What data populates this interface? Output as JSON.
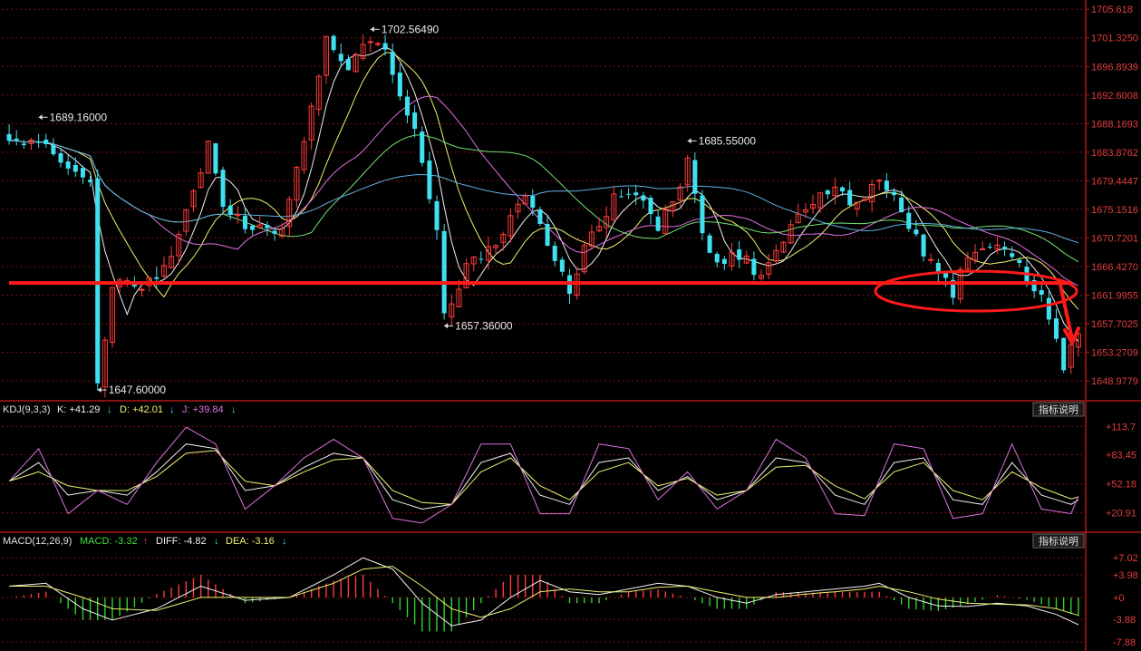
{
  "colors": {
    "background": "#000000",
    "up": "#ff3b3b",
    "down": "#3fe0f0",
    "frame": "#b01818",
    "axis_text": "#e43d3d",
    "grid": "#7a1010",
    "ma_white": "#f0f0f0",
    "ma_yellow": "#f0f070",
    "ma_magenta": "#e070e0",
    "ma_green": "#70e070",
    "ma_cyan": "#60b0e0",
    "annotation": "#ff1a1a",
    "label_bg": "#111111",
    "label_border": "#555555"
  },
  "price_panel": {
    "y_ticks": [
      "1705.618",
      "1701.3250",
      "1696.8939",
      "1692.6008",
      "1688.1693",
      "1683.8762",
      "1679.4447",
      "1675.1516",
      "1670.7201",
      "1666.4270",
      "1661.9955",
      "1657.7025",
      "1653.2709",
      "1648.9779"
    ],
    "callouts": [
      {
        "text": "1702.56490",
        "value": 1702.5649,
        "index": 49
      },
      {
        "text": "1689.16000",
        "value": 1689.16,
        "index": 4
      },
      {
        "text": "1685.55000",
        "value": 1685.55,
        "index": 92
      },
      {
        "text": "1657.36000",
        "value": 1657.36,
        "index": 59
      },
      {
        "text": "1647.60000",
        "value": 1647.6,
        "index": 12
      }
    ],
    "support_line": 1663.9
  },
  "kdj_panel": {
    "legend": {
      "title": "KDJ(9,3,3)",
      "k": "K: +41.29",
      "d": "D: +42.01",
      "j": "J: +39.84"
    },
    "explain_button": "指标说明",
    "y_ticks": [
      "+113.7",
      "+83.45",
      "+52.18",
      "+20.91"
    ]
  },
  "macd_panel": {
    "legend": {
      "title": "MACD(12,26,9)",
      "macd": "MACD: -3.32",
      "diff": "DIFF: -4.82",
      "dea": "DEA: -3.16"
    },
    "explain_button": "指标说明",
    "y_ticks": [
      "+7.02",
      "+3.98",
      "+0",
      "-3.88",
      "-7.88"
    ]
  },
  "chart_data": {
    "type": "candlestick",
    "ylim": [
      1646.5,
      1706.2
    ],
    "close_path": [
      [
        0,
        1685
      ],
      [
        4,
        1686
      ],
      [
        7,
        1683
      ],
      [
        9,
        1681.5
      ],
      [
        11,
        1679
      ],
      [
        12,
        1649
      ],
      [
        14,
        1663
      ],
      [
        16,
        1665
      ],
      [
        18,
        1663
      ],
      [
        22,
        1667
      ],
      [
        27,
        1685
      ],
      [
        29,
        1676
      ],
      [
        33,
        1672
      ],
      [
        37,
        1672
      ],
      [
        43,
        1701
      ],
      [
        46,
        1697
      ],
      [
        49,
        1701
      ],
      [
        51,
        1699
      ],
      [
        55,
        1687
      ],
      [
        58,
        1672
      ],
      [
        59,
        1659
      ],
      [
        62,
        1666
      ],
      [
        66,
        1670
      ],
      [
        70,
        1678
      ],
      [
        74,
        1667
      ],
      [
        76,
        1663
      ],
      [
        79,
        1672
      ],
      [
        83,
        1678
      ],
      [
        86,
        1677
      ],
      [
        88,
        1672
      ],
      [
        90,
        1677
      ],
      [
        92,
        1682
      ],
      [
        94,
        1672
      ],
      [
        96,
        1666
      ],
      [
        98,
        1668
      ],
      [
        100,
        1667
      ],
      [
        102,
        1664
      ],
      [
        104,
        1669
      ],
      [
        106,
        1673
      ],
      [
        109,
        1676
      ],
      [
        112,
        1678
      ],
      [
        115,
        1676
      ],
      [
        118,
        1679
      ],
      [
        120,
        1678
      ],
      [
        122,
        1673
      ],
      [
        124,
        1668
      ],
      [
        126,
        1666
      ],
      [
        128,
        1662
      ],
      [
        130,
        1668
      ],
      [
        132,
        1670
      ],
      [
        134,
        1669
      ],
      [
        136,
        1667
      ],
      [
        138,
        1665
      ],
      [
        140,
        1662
      ],
      [
        142,
        1656
      ],
      [
        143,
        1650
      ],
      [
        145,
        1657
      ]
    ],
    "kdj_k_path": [
      [
        0,
        55
      ],
      [
        4,
        75
      ],
      [
        8,
        40
      ],
      [
        12,
        45
      ],
      [
        16,
        40
      ],
      [
        20,
        65
      ],
      [
        24,
        95
      ],
      [
        28,
        90
      ],
      [
        32,
        45
      ],
      [
        36,
        50
      ],
      [
        40,
        70
      ],
      [
        44,
        85
      ],
      [
        48,
        80
      ],
      [
        52,
        35
      ],
      [
        56,
        25
      ],
      [
        60,
        30
      ],
      [
        64,
        75
      ],
      [
        68,
        85
      ],
      [
        72,
        40
      ],
      [
        76,
        30
      ],
      [
        80,
        75
      ],
      [
        84,
        80
      ],
      [
        88,
        45
      ],
      [
        92,
        60
      ],
      [
        96,
        35
      ],
      [
        100,
        45
      ],
      [
        104,
        80
      ],
      [
        108,
        75
      ],
      [
        112,
        40
      ],
      [
        116,
        30
      ],
      [
        120,
        75
      ],
      [
        124,
        80
      ],
      [
        128,
        35
      ],
      [
        132,
        30
      ],
      [
        136,
        75
      ],
      [
        140,
        40
      ],
      [
        144,
        30
      ],
      [
        145,
        35
      ]
    ],
    "kdj_d_path": [
      [
        0,
        55
      ],
      [
        4,
        65
      ],
      [
        8,
        50
      ],
      [
        12,
        45
      ],
      [
        16,
        45
      ],
      [
        20,
        60
      ],
      [
        24,
        85
      ],
      [
        28,
        88
      ],
      [
        32,
        55
      ],
      [
        36,
        50
      ],
      [
        40,
        65
      ],
      [
        44,
        78
      ],
      [
        48,
        80
      ],
      [
        52,
        45
      ],
      [
        56,
        32
      ],
      [
        60,
        30
      ],
      [
        64,
        65
      ],
      [
        68,
        80
      ],
      [
        72,
        50
      ],
      [
        76,
        35
      ],
      [
        80,
        65
      ],
      [
        84,
        75
      ],
      [
        88,
        50
      ],
      [
        92,
        58
      ],
      [
        96,
        40
      ],
      [
        100,
        45
      ],
      [
        104,
        70
      ],
      [
        108,
        72
      ],
      [
        112,
        50
      ],
      [
        116,
        36
      ],
      [
        120,
        65
      ],
      [
        124,
        75
      ],
      [
        128,
        45
      ],
      [
        132,
        35
      ],
      [
        136,
        65
      ],
      [
        140,
        48
      ],
      [
        144,
        36
      ],
      [
        145,
        38
      ]
    ],
    "kdj_j_path": [
      [
        0,
        55
      ],
      [
        4,
        90
      ],
      [
        8,
        20
      ],
      [
        12,
        45
      ],
      [
        16,
        30
      ],
      [
        20,
        75
      ],
      [
        24,
        113
      ],
      [
        28,
        95
      ],
      [
        32,
        25
      ],
      [
        36,
        50
      ],
      [
        40,
        80
      ],
      [
        44,
        100
      ],
      [
        48,
        80
      ],
      [
        52,
        15
      ],
      [
        56,
        10
      ],
      [
        60,
        30
      ],
      [
        64,
        95
      ],
      [
        68,
        95
      ],
      [
        72,
        20
      ],
      [
        76,
        20
      ],
      [
        80,
        95
      ],
      [
        84,
        90
      ],
      [
        88,
        35
      ],
      [
        92,
        65
      ],
      [
        96,
        25
      ],
      [
        100,
        45
      ],
      [
        104,
        100
      ],
      [
        108,
        80
      ],
      [
        112,
        20
      ],
      [
        116,
        18
      ],
      [
        120,
        95
      ],
      [
        124,
        90
      ],
      [
        128,
        15
      ],
      [
        132,
        20
      ],
      [
        136,
        95
      ],
      [
        140,
        25
      ],
      [
        144,
        20
      ],
      [
        145,
        39
      ]
    ],
    "macd_diff_path": [
      [
        0,
        2
      ],
      [
        5,
        2.5
      ],
      [
        10,
        -2
      ],
      [
        14,
        -4
      ],
      [
        20,
        -2
      ],
      [
        26,
        2
      ],
      [
        32,
        -0.5
      ],
      [
        38,
        0
      ],
      [
        44,
        4
      ],
      [
        48,
        7
      ],
      [
        52,
        5
      ],
      [
        56,
        -1
      ],
      [
        60,
        -5
      ],
      [
        64,
        -4
      ],
      [
        68,
        0
      ],
      [
        72,
        3
      ],
      [
        76,
        1
      ],
      [
        80,
        0.5
      ],
      [
        84,
        1.5
      ],
      [
        88,
        2.5
      ],
      [
        92,
        2
      ],
      [
        96,
        0
      ],
      [
        100,
        -1
      ],
      [
        104,
        0.5
      ],
      [
        108,
        1
      ],
      [
        112,
        1.5
      ],
      [
        116,
        2
      ],
      [
        118,
        2.5
      ],
      [
        122,
        0
      ],
      [
        126,
        -1.5
      ],
      [
        130,
        -1.6
      ],
      [
        134,
        -1
      ],
      [
        138,
        -1.5
      ],
      [
        142,
        -3
      ],
      [
        145,
        -4.82
      ]
    ],
    "macd_dea_path": [
      [
        0,
        2
      ],
      [
        5,
        2
      ],
      [
        10,
        0
      ],
      [
        14,
        -2
      ],
      [
        20,
        -2.3
      ],
      [
        26,
        0
      ],
      [
        32,
        0
      ],
      [
        38,
        0
      ],
      [
        44,
        2.5
      ],
      [
        48,
        5
      ],
      [
        52,
        5.5
      ],
      [
        56,
        2
      ],
      [
        60,
        -2
      ],
      [
        64,
        -3.5
      ],
      [
        68,
        -2
      ],
      [
        72,
        1
      ],
      [
        76,
        1.5
      ],
      [
        80,
        1
      ],
      [
        84,
        1
      ],
      [
        88,
        1.8
      ],
      [
        92,
        2
      ],
      [
        96,
        1
      ],
      [
        100,
        0
      ],
      [
        104,
        0
      ],
      [
        108,
        0.6
      ],
      [
        112,
        1
      ],
      [
        116,
        1.5
      ],
      [
        118,
        2
      ],
      [
        122,
        1
      ],
      [
        126,
        -0.3
      ],
      [
        130,
        -1
      ],
      [
        134,
        -1.2
      ],
      [
        138,
        -1.3
      ],
      [
        142,
        -2
      ],
      [
        145,
        -3.16
      ]
    ]
  }
}
